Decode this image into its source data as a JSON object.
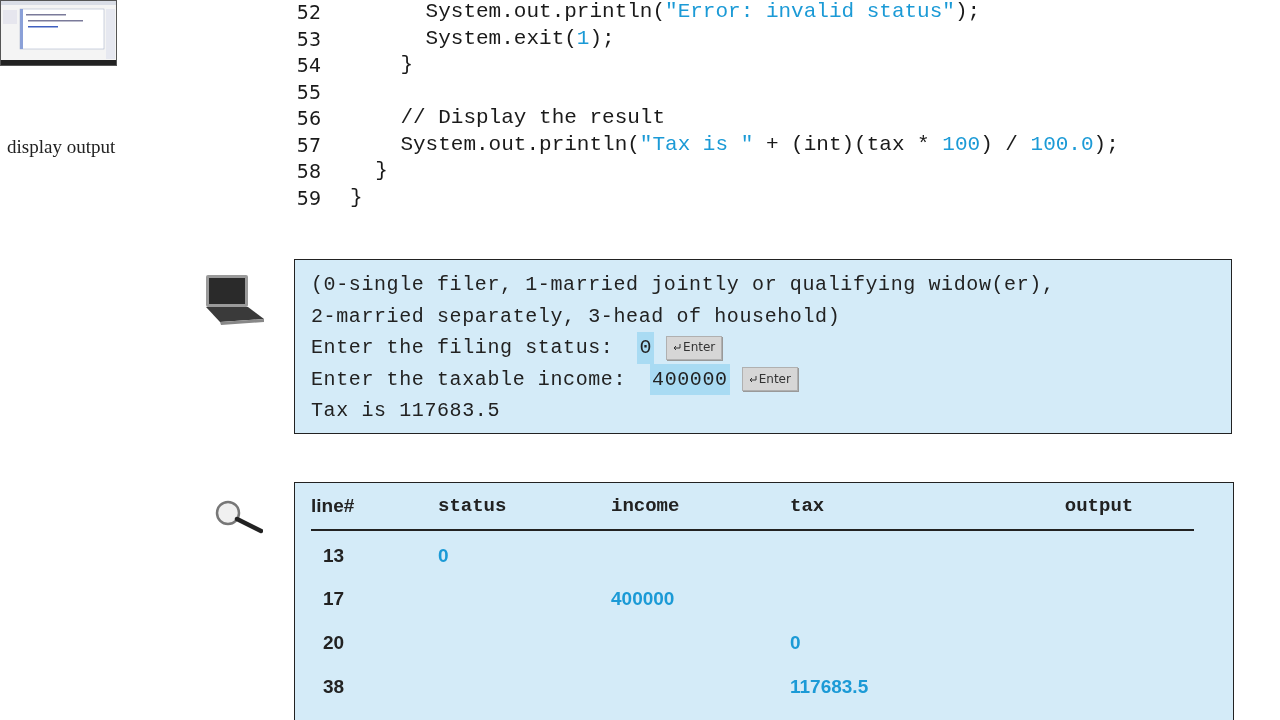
{
  "thumbnail": {
    "kind": "picture"
  },
  "step_label": "display output",
  "code": [
    {
      "number": "52",
      "segments": [
        {
          "kind": "plain",
          "text": "      System.out.println("
        },
        {
          "kind": "string",
          "text": "\"Error: invalid status\""
        },
        {
          "kind": "plain",
          "text": ");"
        }
      ]
    },
    {
      "number": "53",
      "segments": [
        {
          "kind": "plain",
          "text": "      System.exit("
        },
        {
          "kind": "number",
          "text": "1"
        },
        {
          "kind": "plain",
          "text": ");"
        }
      ]
    },
    {
      "number": "54",
      "segments": [
        {
          "kind": "plain",
          "text": "    }"
        }
      ]
    },
    {
      "number": "55"
    },
    {
      "number": "56",
      "segments": [
        {
          "kind": "plain",
          "text": "    // Display the result"
        }
      ]
    },
    {
      "number": "57",
      "segments": [
        {
          "kind": "plain",
          "text": "    System.out.println("
        },
        {
          "kind": "string",
          "text": "\"Tax is \""
        },
        {
          "kind": "plain",
          "text": " + (int)(tax * "
        },
        {
          "kind": "number",
          "text": "100"
        },
        {
          "kind": "plain",
          "text": ") / "
        },
        {
          "kind": "number",
          "text": "100.0"
        },
        {
          "kind": "plain",
          "text": ");"
        }
      ]
    },
    {
      "number": "58",
      "segments": [
        {
          "kind": "plain",
          "text": "  }"
        }
      ]
    },
    {
      "number": "59",
      "segments": [
        {
          "kind": "plain",
          "text": "}"
        }
      ]
    }
  ],
  "console": [
    [
      {
        "kind": "output",
        "text": "(0-single filer, 1-married jointly or qualifying widow(er),"
      }
    ],
    [
      {
        "kind": "output",
        "text": "2-married separately, 3-head of household)"
      }
    ],
    [
      {
        "kind": "output",
        "text": "Enter the filing status:"
      },
      {
        "kind": "input",
        "text": "0"
      },
      {
        "kind": "key",
        "text": "Enter"
      }
    ],
    [
      {
        "kind": "output",
        "text": "Enter the taxable income:"
      },
      {
        "kind": "input",
        "text": "400000"
      },
      {
        "kind": "key",
        "text": "Enter"
      }
    ],
    [
      {
        "kind": "output",
        "text": "Tax is 117683.5"
      }
    ]
  ],
  "trace_table": {
    "columns": [
      "line#",
      "status",
      "income",
      "tax",
      "output"
    ],
    "rows": [
      [
        "13",
        "0",
        "",
        "",
        ""
      ],
      [
        "17",
        "",
        "400000",
        "",
        ""
      ],
      [
        "20",
        "",
        "",
        "0",
        ""
      ],
      [
        "38",
        "",
        "",
        "117683.5",
        ""
      ]
    ]
  }
}
